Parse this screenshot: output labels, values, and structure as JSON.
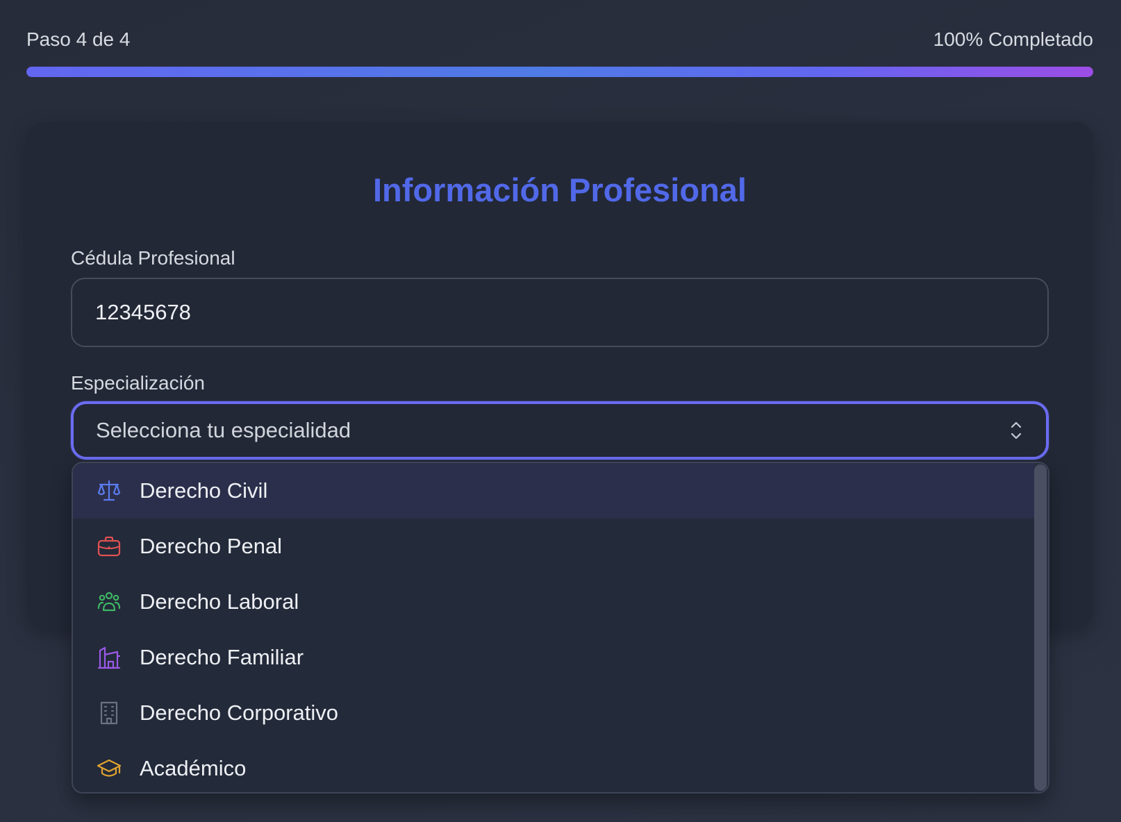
{
  "progress": {
    "step_label": "Paso 4 de 4",
    "percent_label": "100% Completado",
    "value": 1.0
  },
  "card": {
    "title": "Información Profesional"
  },
  "form": {
    "cedula": {
      "label": "Cédula Profesional",
      "value": "12345678"
    },
    "especializacion": {
      "label": "Especialización",
      "placeholder": "Selecciona tu especialidad",
      "options": [
        {
          "label": "Derecho Civil",
          "icon": "scale-icon",
          "color": "#5b7cf0"
        },
        {
          "label": "Derecho Penal",
          "icon": "briefcase-icon",
          "color": "#e05252"
        },
        {
          "label": "Derecho Laboral",
          "icon": "users-icon",
          "color": "#3fb764"
        },
        {
          "label": "Derecho Familiar",
          "icon": "home-icon",
          "color": "#9b59e8"
        },
        {
          "label": "Derecho Corporativo",
          "icon": "building-icon",
          "color": "#6b7280"
        },
        {
          "label": "Académico",
          "icon": "graduation-cap-icon",
          "color": "#e0a431"
        }
      ]
    }
  },
  "colors": {
    "accent": "#6366f1",
    "title": "#5169e8",
    "background": "#282d3b",
    "card": "#222836"
  }
}
